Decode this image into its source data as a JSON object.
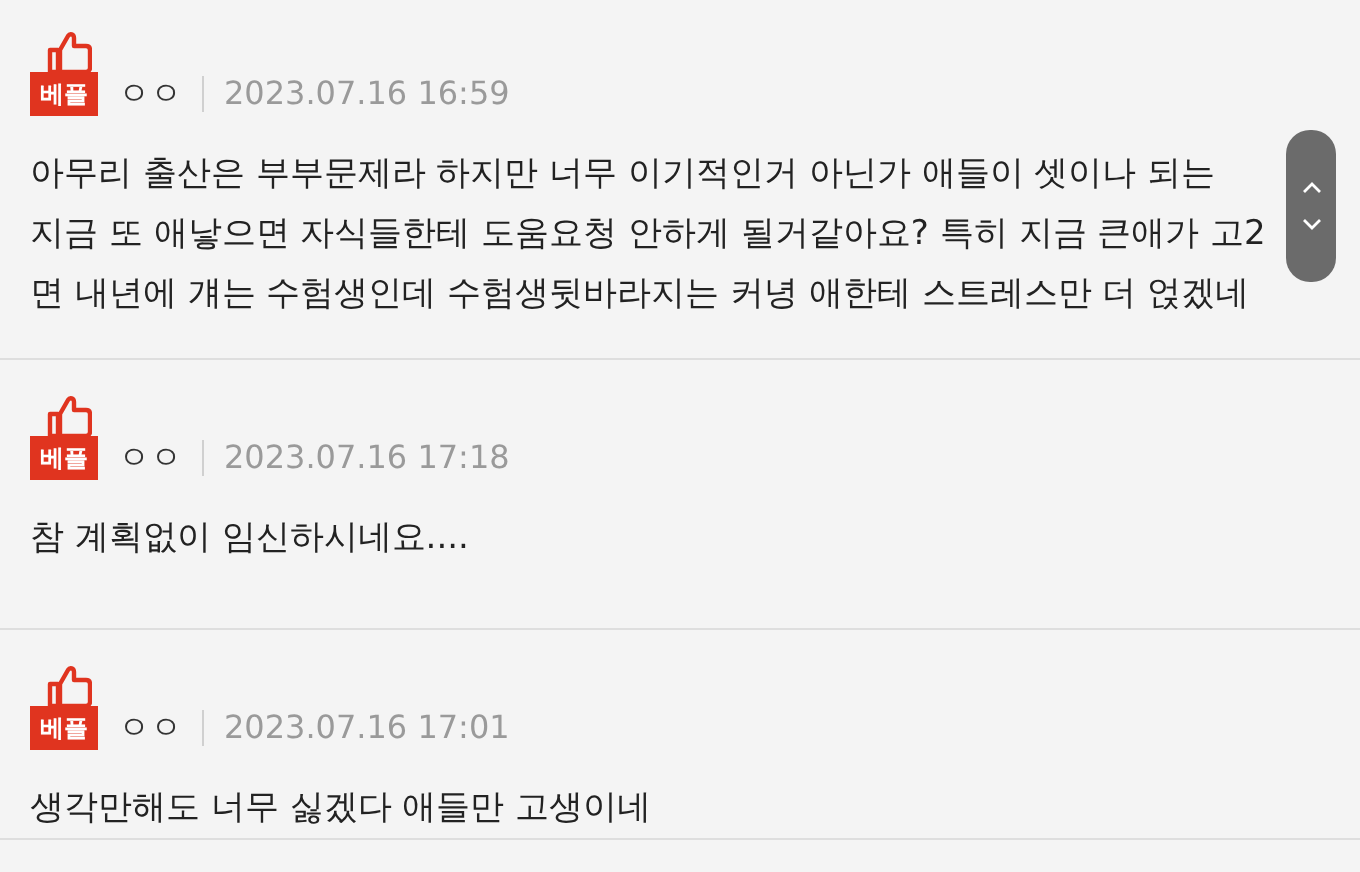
{
  "comments": [
    {
      "badge": "베플",
      "author": "ㅇㅇ",
      "date": "2023.07.16 16:59",
      "lines": [
        "아무리 출산은 부부문제라 하지만 너무 이기적인거 아닌가 애들이 셋이나 되는",
        "지금 또 애낳으면 자식들한테 도움요청 안하게 될거같아요? 특히 지금 큰애가 고2",
        "면 내년에 걔는 수험생인데 수험생뒷바라지는 커녕 애한테 스트레스만 더 얹겠네"
      ]
    },
    {
      "badge": "베플",
      "author": "ㅇㅇ",
      "date": "2023.07.16 17:18",
      "lines": [
        "참 계획없이 임신하시네요...."
      ]
    },
    {
      "badge": "베플",
      "author": "ㅇㅇ",
      "date": "2023.07.16 17:01",
      "lines": [
        "생각만해도 너무 싫겠다 애들만 고생이네"
      ]
    }
  ]
}
